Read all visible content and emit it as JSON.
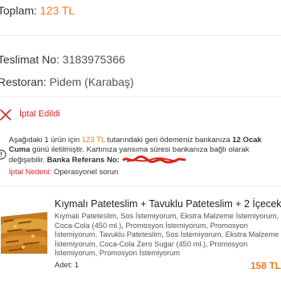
{
  "order": {
    "total_label": "Toplam:",
    "total_value": "123 TL",
    "delivery_label": "Teslimat No:",
    "delivery_value": "3183975366",
    "restaurant_label": "Restoran:",
    "restaurant_value": "Pidem (Karabaş)"
  },
  "cancel": {
    "status": "İptal Edildi",
    "icon": "close-icon",
    "color": "#d9261c"
  },
  "refund": {
    "icon": "info-icon",
    "line_prefix": "Aşağıdaki 1 ürün için ",
    "amount": "123 TL",
    "line_mid": " tutarındaki geri ödemeniz bankanıza ",
    "date": "12 Ocak Cuma",
    "line_suffix": " günü iletilmiştir. Kartınıza yansıma süresi bankanıza bağlı olarak değişebilir. ",
    "ref_label": "Banka Referans No:",
    "reason_label": "İptal Nedeni:",
    "reason_value": "Operasyonel sorun"
  },
  "product": {
    "title": "Kıymalı Pateteslim + Tavuklu Pateteslim + 2 İçecek",
    "description": "Kıymalı Pateteslim, Sos İstemiyorum, Ekstra Malzeme İstemiyorum, Coca-Cola (450 ml.), Promosyon İstemiyorum, Promosyon İstemiyorum, Tavuklu Pateteslim, Sos İstemiyorum, Ekstra Malzeme İstemiyorum, Coca-Cola Zero Sugar (450 ml.), Promosyon İstemiyorum, Promosyon İstemiyorum",
    "quantity": "Adet: 1",
    "price": "158 TL"
  },
  "colors": {
    "accent": "#f27a1a",
    "cancel": "#d9261c"
  }
}
